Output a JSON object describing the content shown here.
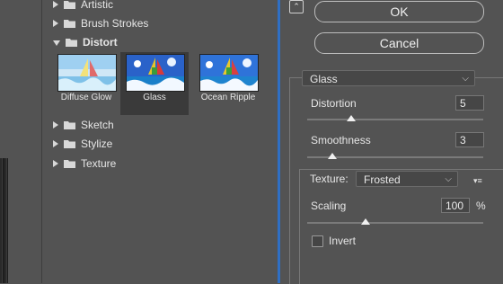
{
  "tree": {
    "categories": [
      {
        "label": "Artistic",
        "expanded": false
      },
      {
        "label": "Brush Strokes",
        "expanded": false
      },
      {
        "label": "Distort",
        "expanded": true
      },
      {
        "label": "Sketch",
        "expanded": false
      },
      {
        "label": "Stylize",
        "expanded": false
      },
      {
        "label": "Texture",
        "expanded": false
      }
    ],
    "thumbnails": [
      {
        "label": "Diffuse Glow",
        "selected": false
      },
      {
        "label": "Glass",
        "selected": true
      },
      {
        "label": "Ocean Ripple",
        "selected": false
      }
    ]
  },
  "buttons": {
    "ok": "OK",
    "cancel": "Cancel",
    "collapse_icon": "double-chevron-up-icon"
  },
  "filter": {
    "selected": "Glass",
    "distortion": {
      "label": "Distortion",
      "value": "5",
      "range": [
        0,
        20
      ]
    },
    "smoothness": {
      "label": "Smoothness",
      "value": "3",
      "range": [
        1,
        15
      ]
    },
    "texture": {
      "label": "Texture:",
      "selected": "Frosted"
    },
    "scaling": {
      "label": "Scaling",
      "value": "100",
      "unit": "%",
      "range": [
        50,
        200
      ]
    },
    "invert": {
      "label": "Invert",
      "checked": false
    }
  },
  "colors": {
    "accent": "#2f6fc4",
    "background": "#535353"
  }
}
